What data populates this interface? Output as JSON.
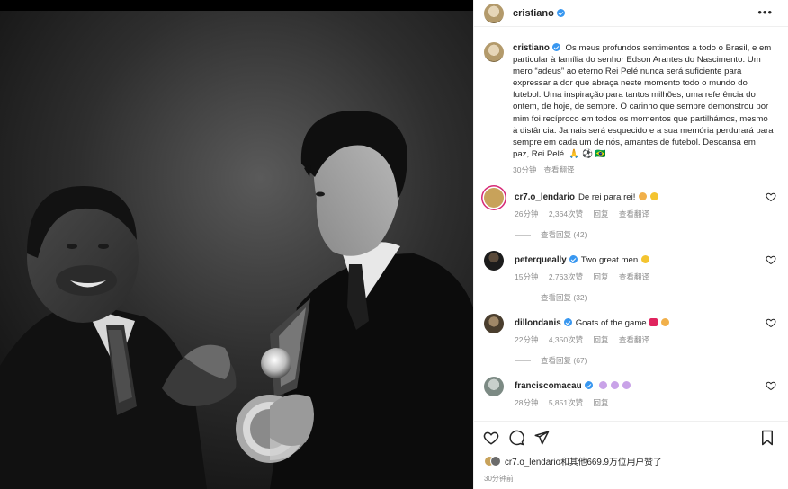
{
  "post": {
    "author": "cristiano",
    "caption": "Os meus profundos sentimentos a todo o Brasil, e em particular à família do senhor Edson Arantes do Nascimento. Um mero “adeus” ao eterno Rei Pelé nunca será suficiente para expressar a dor que abraça neste momento todo o mundo do futebol. Uma inspiração para tantos milhões, uma referência do ontem, de hoje, de sempre. O carinho que sempre demonstrou por mim foi recíproco em todos os momentos que partilhámos, mesmo à distância. Jamais será esquecido e a sua memória perdurará para sempre em cada um de nós, amantes de futebol. Descansa em paz, Rei Pelé. 🙏 ⚽ 🇧🇷",
    "caption_time": "30分钟",
    "see_translation": "查看翻译",
    "more_icon": "more-options-icon",
    "liked_by_text": "cr7.o_lendario和其他669.9万位用户赞了",
    "post_time": "30分钟前"
  },
  "comments": [
    {
      "username": "cr7.o_lendario",
      "text": "De rei para rei!",
      "verified": false,
      "time": "26分钟",
      "likes": "2,364次赞",
      "reply": "回复",
      "translate": "查看翻译",
      "view_replies": "查看回复 (42)",
      "avatar_color": "#c8a25a",
      "ring": true
    },
    {
      "username": "peterqueally",
      "text": "Two great men",
      "verified": true,
      "time": "15分钟",
      "likes": "2,763次赞",
      "reply": "回复",
      "translate": "查看翻译",
      "view_replies": "查看回复 (32)",
      "avatar_color": "#2a2a2a",
      "ring": false
    },
    {
      "username": "dillondanis",
      "text": "Goats of the game",
      "verified": true,
      "time": "22分钟",
      "likes": "4,350次赞",
      "reply": "回复",
      "translate": "查看翻译",
      "view_replies": "查看回复 (67)",
      "avatar_color": "#5b4e3a",
      "ring": false
    },
    {
      "username": "franciscomacau",
      "text": "",
      "verified": true,
      "time": "28分钟",
      "likes": "5,851次赞",
      "reply": "回复",
      "translate": "",
      "view_replies": "",
      "avatar_color": "#9aa59f",
      "ring": false
    }
  ],
  "colors": {
    "verified": "#3897f0",
    "secondary_text": "#8e8e8e",
    "border": "#efefef"
  },
  "icons": [
    "heart-icon",
    "comment-icon",
    "share-icon",
    "bookmark-icon",
    "verified-badge-icon"
  ]
}
